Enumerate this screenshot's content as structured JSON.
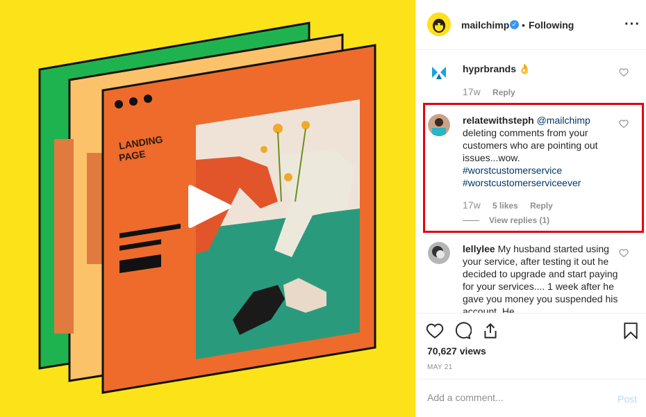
{
  "colors": {
    "background_yellow": "#fce319",
    "window_orange": "#ee6b2c",
    "window_peach": "#fbc26a",
    "window_green": "#1fb34f",
    "link_blue": "#003569",
    "highlight_red": "#e3000f"
  },
  "media": {
    "landing_label_line1": "LANDING",
    "landing_label_line2": "PAGE",
    "play_icon": "play-icon"
  },
  "header": {
    "username": "mailchimp",
    "verified_icon": "verified-badge-icon",
    "separator": "•",
    "follow_status": "Following",
    "more_icon": "more-options-icon",
    "more_glyph": "···"
  },
  "comments": [
    {
      "username": "hyprbrands",
      "text": "👌",
      "age": "17w",
      "reply_label": "Reply"
    },
    {
      "username": "relatewithsteph",
      "mention": "@mailchimp",
      "text": "deleting comments from your customers who are pointing out issues...wow.",
      "hashtag1": "#worstcustomerservice",
      "hashtag2": "#worstcustomerserviceever",
      "age": "17w",
      "likes": "5 likes",
      "reply_label": "Reply",
      "view_replies": "View replies (1)"
    },
    {
      "username": "lellylee",
      "text": "My husband started using your service, after testing it out he decided to upgrade and start paying for your services.... 1 week after he gave you money you suspended his account. He"
    }
  ],
  "actions": {
    "like_icon": "heart-icon",
    "comment_icon": "comment-icon",
    "share_icon": "share-icon",
    "save_icon": "bookmark-icon",
    "views": "70,627 views",
    "date": "MAY 21"
  },
  "add_comment": {
    "placeholder": "Add a comment...",
    "post_label": "Post"
  }
}
